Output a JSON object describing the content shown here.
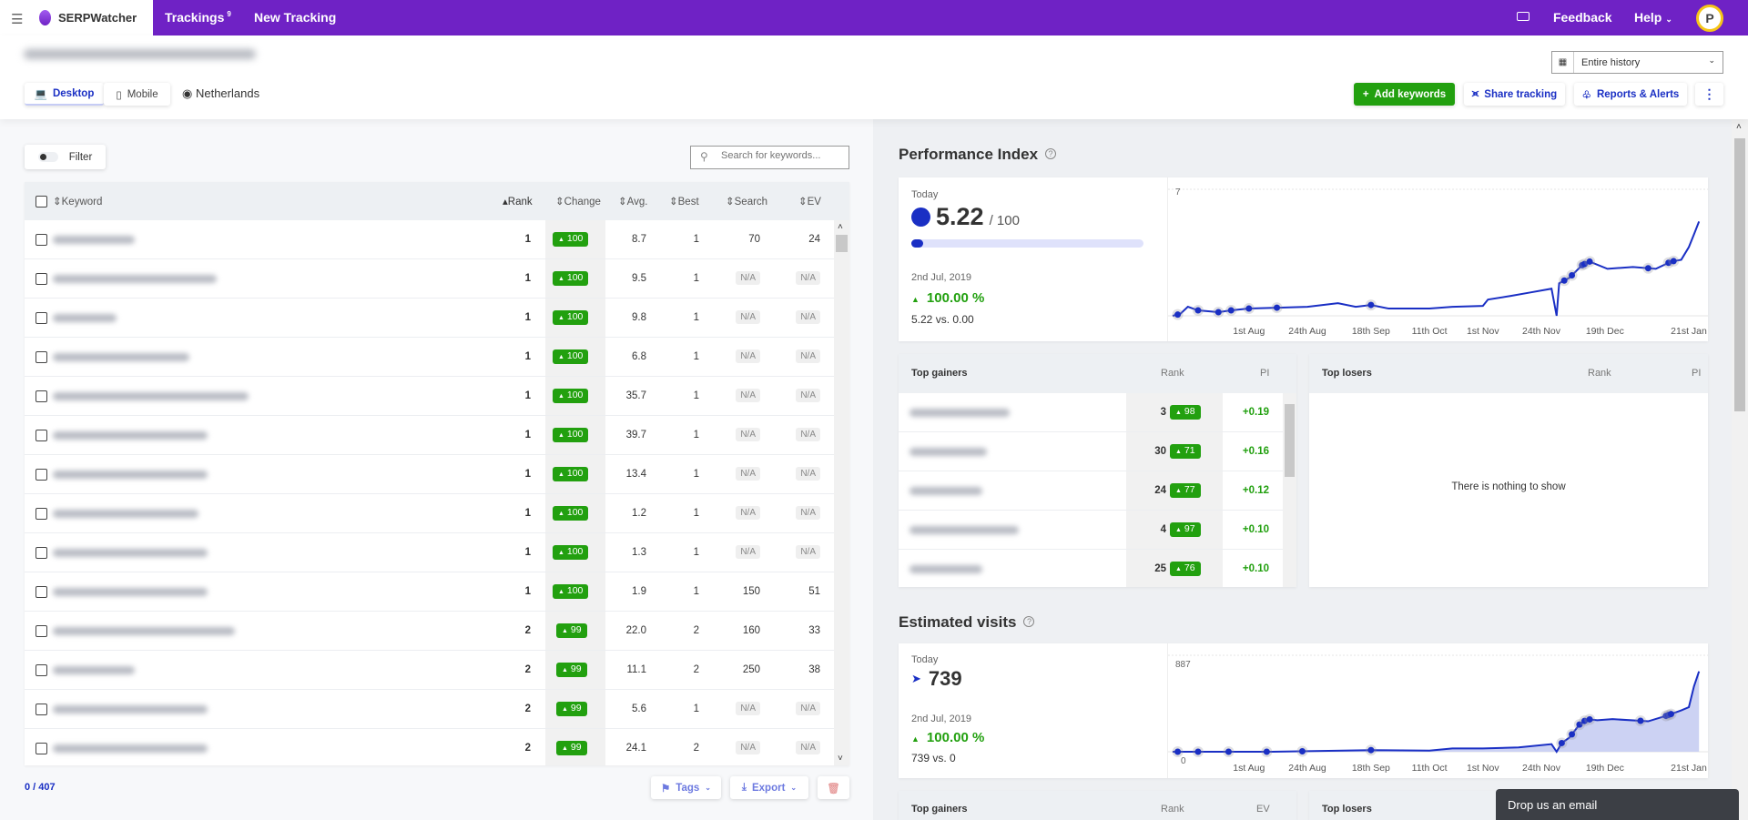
{
  "nav": {
    "app_name": "SERPWatcher",
    "trackings_label": "Trackings",
    "trackings_count": "9",
    "new_tracking_label": "New Tracking",
    "feedback_label": "Feedback",
    "help_label": "Help"
  },
  "header": {
    "device_tabs": [
      {
        "label": "Desktop",
        "active": true
      },
      {
        "label": "Mobile",
        "active": false
      }
    ],
    "location": "Netherlands",
    "date_range": "Entire history",
    "add_keywords": "Add keywords",
    "share_tracking": "Share tracking",
    "reports_alerts": "Reports & Alerts"
  },
  "toolbar": {
    "filter_label": "Filter",
    "search_placeholder": "Search for keywords..."
  },
  "table": {
    "columns": [
      "Keyword",
      "Rank",
      "Change",
      "Avg.",
      "Best",
      "Search",
      "EV"
    ],
    "rows": [
      {
        "rank": "1",
        "change": "100",
        "avg": "8.7",
        "best": "1",
        "search": "70",
        "ev": "24"
      },
      {
        "rank": "1",
        "change": "100",
        "avg": "9.5",
        "best": "1",
        "search": "N/A",
        "ev": "N/A"
      },
      {
        "rank": "1",
        "change": "100",
        "avg": "9.8",
        "best": "1",
        "search": "N/A",
        "ev": "N/A"
      },
      {
        "rank": "1",
        "change": "100",
        "avg": "6.8",
        "best": "1",
        "search": "N/A",
        "ev": "N/A"
      },
      {
        "rank": "1",
        "change": "100",
        "avg": "35.7",
        "best": "1",
        "search": "N/A",
        "ev": "N/A"
      },
      {
        "rank": "1",
        "change": "100",
        "avg": "39.7",
        "best": "1",
        "search": "N/A",
        "ev": "N/A"
      },
      {
        "rank": "1",
        "change": "100",
        "avg": "13.4",
        "best": "1",
        "search": "N/A",
        "ev": "N/A"
      },
      {
        "rank": "1",
        "change": "100",
        "avg": "1.2",
        "best": "1",
        "search": "N/A",
        "ev": "N/A"
      },
      {
        "rank": "1",
        "change": "100",
        "avg": "1.3",
        "best": "1",
        "search": "N/A",
        "ev": "N/A"
      },
      {
        "rank": "1",
        "change": "100",
        "avg": "1.9",
        "best": "1",
        "search": "150",
        "ev": "51"
      },
      {
        "rank": "2",
        "change": "99",
        "avg": "22.0",
        "best": "2",
        "search": "160",
        "ev": "33"
      },
      {
        "rank": "2",
        "change": "99",
        "avg": "11.1",
        "best": "2",
        "search": "250",
        "ev": "38"
      },
      {
        "rank": "2",
        "change": "99",
        "avg": "5.6",
        "best": "1",
        "search": "N/A",
        "ev": "N/A"
      },
      {
        "rank": "2",
        "change": "99",
        "avg": "24.1",
        "best": "2",
        "search": "N/A",
        "ev": "N/A"
      }
    ],
    "selected_count": "0 / 407",
    "tags_label": "Tags",
    "export_label": "Export"
  },
  "performance": {
    "title": "Performance Index",
    "today_label": "Today",
    "value": "5.22",
    "max": "/ 100",
    "progress_percent": 5.22,
    "date": "2nd Jul, 2019",
    "change": "100.00 %",
    "compare": "5.22 vs. 0.00"
  },
  "gainers": {
    "title": "Top gainers",
    "rank_label": "Rank",
    "pi_label": "PI",
    "rows": [
      {
        "rank": "3",
        "change": "98",
        "pi": "+0.19"
      },
      {
        "rank": "30",
        "change": "71",
        "pi": "+0.16"
      },
      {
        "rank": "24",
        "change": "77",
        "pi": "+0.12"
      },
      {
        "rank": "4",
        "change": "97",
        "pi": "+0.10"
      },
      {
        "rank": "25",
        "change": "76",
        "pi": "+0.10"
      }
    ]
  },
  "losers": {
    "title": "Top losers",
    "rank_label": "Rank",
    "pi_label": "PI",
    "empty": "There is nothing to show"
  },
  "visits": {
    "title": "Estimated visits",
    "today_label": "Today",
    "value": "739",
    "date": "2nd Jul, 2019",
    "change": "100.00 %",
    "compare": "739 vs. 0"
  },
  "gainers2": {
    "title": "Top gainers",
    "rank_label": "Rank",
    "ev_label": "EV"
  },
  "losers2": {
    "title": "Top losers"
  },
  "email_widget": "Drop us an email",
  "colors": {
    "brand": "#6f22c5",
    "accent": "#1a2fc4",
    "positive": "#22a00f"
  },
  "chart_data": [
    {
      "type": "line",
      "ylim": [
        0,
        7
      ],
      "y_tick_labels": [
        "7"
      ],
      "x_tick_labels": [
        "1st Aug",
        "24th Aug",
        "18th Sep",
        "11th Oct",
        "1st Nov",
        "24th Nov",
        "19th Dec",
        "21st Jan"
      ],
      "x_tick_dates": [
        "2019-08-01",
        "2019-08-24",
        "2019-09-18",
        "2019-10-11",
        "2019-11-01",
        "2019-11-24",
        "2019-12-19",
        "2020-01-21"
      ],
      "points": [
        [
          "2019-07-02",
          0
        ],
        [
          "2019-07-05",
          0.1
        ],
        [
          "2019-07-08",
          0.5
        ],
        [
          "2019-07-12",
          0.3
        ],
        [
          "2019-07-20",
          0.2
        ],
        [
          "2019-07-25",
          0.3
        ],
        [
          "2019-08-01",
          0.4
        ],
        [
          "2019-08-12",
          0.45
        ],
        [
          "2019-08-24",
          0.5
        ],
        [
          "2019-09-05",
          0.7
        ],
        [
          "2019-09-12",
          0.5
        ],
        [
          "2019-09-18",
          0.6
        ],
        [
          "2019-09-25",
          0.4
        ],
        [
          "2019-10-11",
          0.4
        ],
        [
          "2019-10-20",
          0.5
        ],
        [
          "2019-11-01",
          0.55
        ],
        [
          "2019-11-03",
          0.9
        ],
        [
          "2019-11-12",
          1.1
        ],
        [
          "2019-11-20",
          1.3
        ],
        [
          "2019-11-28",
          1.5
        ],
        [
          "2019-11-30",
          0
        ],
        [
          "2019-12-01",
          1.8
        ],
        [
          "2019-12-05",
          2.1
        ],
        [
          "2019-12-10",
          2.8
        ],
        [
          "2019-12-13",
          3.0
        ],
        [
          "2019-12-20",
          2.6
        ],
        [
          "2019-12-30",
          2.7
        ],
        [
          "2020-01-08",
          2.6
        ],
        [
          "2020-01-14",
          3.0
        ],
        [
          "2020-01-18",
          3.1
        ],
        [
          "2020-01-21",
          3.8
        ],
        [
          "2020-01-23",
          4.5
        ],
        [
          "2020-01-25",
          5.22
        ]
      ],
      "markers": [
        "2019-07-04",
        "2019-07-12",
        "2019-07-20",
        "2019-07-25",
        "2019-08-01",
        "2019-08-12",
        "2019-09-18",
        "2019-12-03",
        "2019-12-06",
        "2019-12-10",
        "2019-12-11",
        "2019-12-13",
        "2020-01-05",
        "2020-01-13",
        "2020-01-15"
      ]
    },
    {
      "type": "area",
      "ylim": [
        0,
        887
      ],
      "y_tick_labels": [
        "887",
        "0"
      ],
      "x_tick_labels": [
        "1st Aug",
        "24th Aug",
        "18th Sep",
        "11th Oct",
        "1st Nov",
        "24th Nov",
        "19th Dec",
        "21st Jan"
      ],
      "x_tick_dates": [
        "2019-08-01",
        "2019-08-24",
        "2019-09-18",
        "2019-10-11",
        "2019-11-01",
        "2019-11-24",
        "2019-12-19",
        "2020-01-21"
      ],
      "points": [
        [
          "2019-07-02",
          0
        ],
        [
          "2019-08-10",
          0
        ],
        [
          "2019-08-24",
          5
        ],
        [
          "2019-09-18",
          15
        ],
        [
          "2019-10-11",
          10
        ],
        [
          "2019-10-20",
          30
        ],
        [
          "2019-11-01",
          30
        ],
        [
          "2019-11-15",
          40
        ],
        [
          "2019-11-28",
          70
        ],
        [
          "2019-11-30",
          0
        ],
        [
          "2019-12-02",
          80
        ],
        [
          "2019-12-05",
          130
        ],
        [
          "2019-12-09",
          250
        ],
        [
          "2019-12-12",
          300
        ],
        [
          "2019-12-16",
          290
        ],
        [
          "2019-12-22",
          300
        ],
        [
          "2020-01-05",
          280
        ],
        [
          "2020-01-12",
          330
        ],
        [
          "2020-01-18",
          380
        ],
        [
          "2020-01-21",
          410
        ],
        [
          "2020-01-23",
          600
        ],
        [
          "2020-01-25",
          739
        ]
      ],
      "markers": [
        "2019-07-04",
        "2019-07-12",
        "2019-07-24",
        "2019-08-08",
        "2019-08-22",
        "2019-09-18",
        "2019-12-02",
        "2019-12-06",
        "2019-12-09",
        "2019-12-11",
        "2019-12-13",
        "2020-01-02",
        "2020-01-12",
        "2020-01-13",
        "2020-01-14"
      ]
    }
  ]
}
